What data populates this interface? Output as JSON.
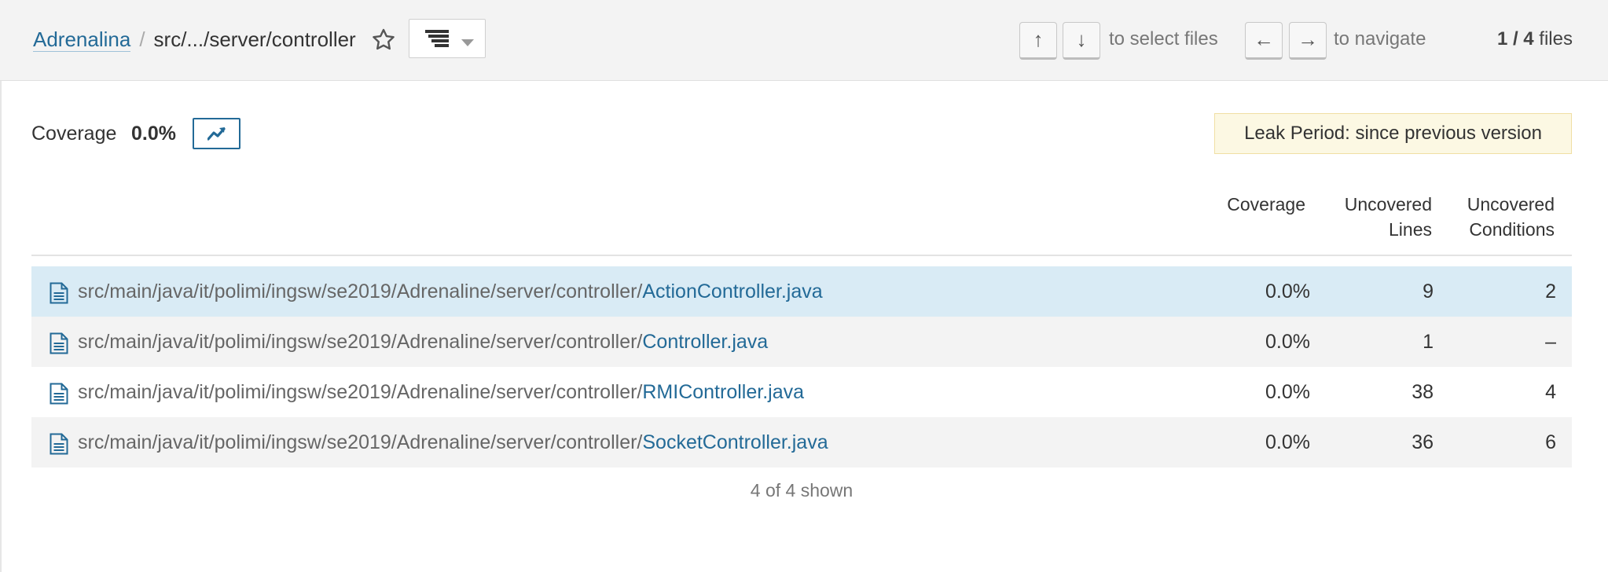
{
  "breadcrumb": {
    "project": "Adrenalina",
    "separator": "/",
    "current": "src/.../server/controller"
  },
  "icons": {
    "star": "star-outline-icon",
    "view": "tree-list-icon",
    "caret": "caret-down-icon",
    "trend": "trend-chart-icon",
    "file": "file-icon"
  },
  "shortcuts": {
    "up_key": "↑",
    "down_key": "↓",
    "select_hint": "to select files",
    "left_key": "←",
    "right_key": "→",
    "navigate_hint": "to navigate"
  },
  "files_count": {
    "position": "1 / 4",
    "label": " files"
  },
  "measure": {
    "label": "Coverage",
    "value": "0.0%"
  },
  "leak_period": "Leak Period: since previous version",
  "columns": {
    "coverage": "Coverage",
    "uncovered_lines_1": "Uncovered",
    "uncovered_lines_2": "Lines",
    "uncovered_conditions_1": "Uncovered",
    "uncovered_conditions_2": "Conditions"
  },
  "rows": [
    {
      "dir": "src/main/java/it/polimi/ingsw/se2019/Adrenaline/server/controller/",
      "file": "ActionController.java",
      "coverage": "0.0%",
      "uncovered_lines": "9",
      "uncovered_conditions": "2"
    },
    {
      "dir": "src/main/java/it/polimi/ingsw/se2019/Adrenaline/server/controller/",
      "file": "Controller.java",
      "coverage": "0.0%",
      "uncovered_lines": "1",
      "uncovered_conditions": "–"
    },
    {
      "dir": "src/main/java/it/polimi/ingsw/se2019/Adrenaline/server/controller/",
      "file": "RMIController.java",
      "coverage": "0.0%",
      "uncovered_lines": "38",
      "uncovered_conditions": "4"
    },
    {
      "dir": "src/main/java/it/polimi/ingsw/se2019/Adrenaline/server/controller/",
      "file": "SocketController.java",
      "coverage": "0.0%",
      "uncovered_lines": "36",
      "uncovered_conditions": "6"
    }
  ],
  "shown_text": "4 of 4 shown",
  "colors": {
    "link": "#236a97",
    "selected_row": "#d9ebf5",
    "striped_row": "#f3f3f3",
    "leak_background": "#fcf8e3",
    "topbar": "#f3f3f3"
  }
}
